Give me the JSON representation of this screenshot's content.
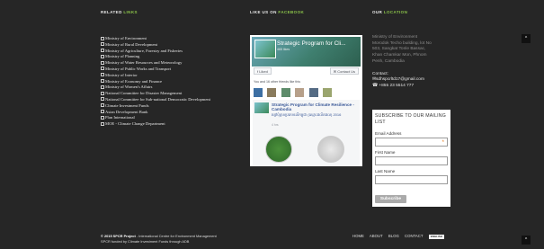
{
  "related": {
    "title_prefix": "RELATED",
    "title_highlight": "LINKS"
  },
  "links": [
    "Ministry of Environment",
    "Ministry of Rural Development",
    "Ministry of Agriculture, Forestry and Fisheries",
    "Ministry of Planning",
    "Ministry of Water Resources and Meteorology",
    "Ministry of Public Works and Transport",
    "Ministry of Interior",
    "Ministry of Economy and Finance",
    "Ministry of Women's Affairs",
    "National Committee for Disaster Management",
    "National Committee for Sub-national Democratic Development",
    "Climate Investment Funds",
    "Asian Development Bank",
    "Plan International",
    "MOE - Climate Change Department"
  ],
  "facebook_section": {
    "title_prefix": "LIKE US ON",
    "title_highlight": "FACEBOOK"
  },
  "facebook": {
    "page_name": "Strategic Program for Cli...",
    "likes": "465 likes",
    "liked_label": "Liked",
    "contact_label": "Contact Us",
    "friends_text": "You and 16 other friends like this",
    "post_title": "Strategic Program for Climate Resilience - Cambodia",
    "post_subtitle": "ម្សៅប៉ុន្មានប្រភេទលើកម្ពុជា (ឈ្មោះផលិតផល) 2016",
    "post_time": "4 hrs"
  },
  "location": {
    "title_prefix": "OUR",
    "title_highlight": "LOCATION",
    "address_lines": [
      "Ministry of Environment",
      "Morodok Techo building, lot No",
      "503, Sangkat Tonle Bassac,",
      "Khan Chamkar Mon, Phnom",
      "Penh, Cambodia"
    ],
    "contact_label": "Contact:",
    "email": "sdhspcrltd17@gmail.com",
    "phone": "+855 23 5514 777"
  },
  "newsletter": {
    "title": "SUBSCRIBE TO OUR MAILING LIST",
    "email_label": "Email Address",
    "required_mark": "*",
    "first_name_label": "First Name",
    "last_name_label": "Last Name",
    "subscribe_label": "Subscribe"
  },
  "back_to_top_icon": "^",
  "footer": {
    "copyright_bold": "© 2015 SPCR Project",
    "copyright_rest": " - International Centre for Environment Management",
    "funded": "SPCR funded by Climate Investment Funds through ADB",
    "nav": [
      "HOME",
      "ABOUT",
      "BLOG",
      "CONTACT"
    ],
    "language": "ENGLISH"
  },
  "colors": {
    "accent": "#8bc34a",
    "background": "#262626",
    "facebook_blue": "#3b5998",
    "required": "#e67e22"
  }
}
